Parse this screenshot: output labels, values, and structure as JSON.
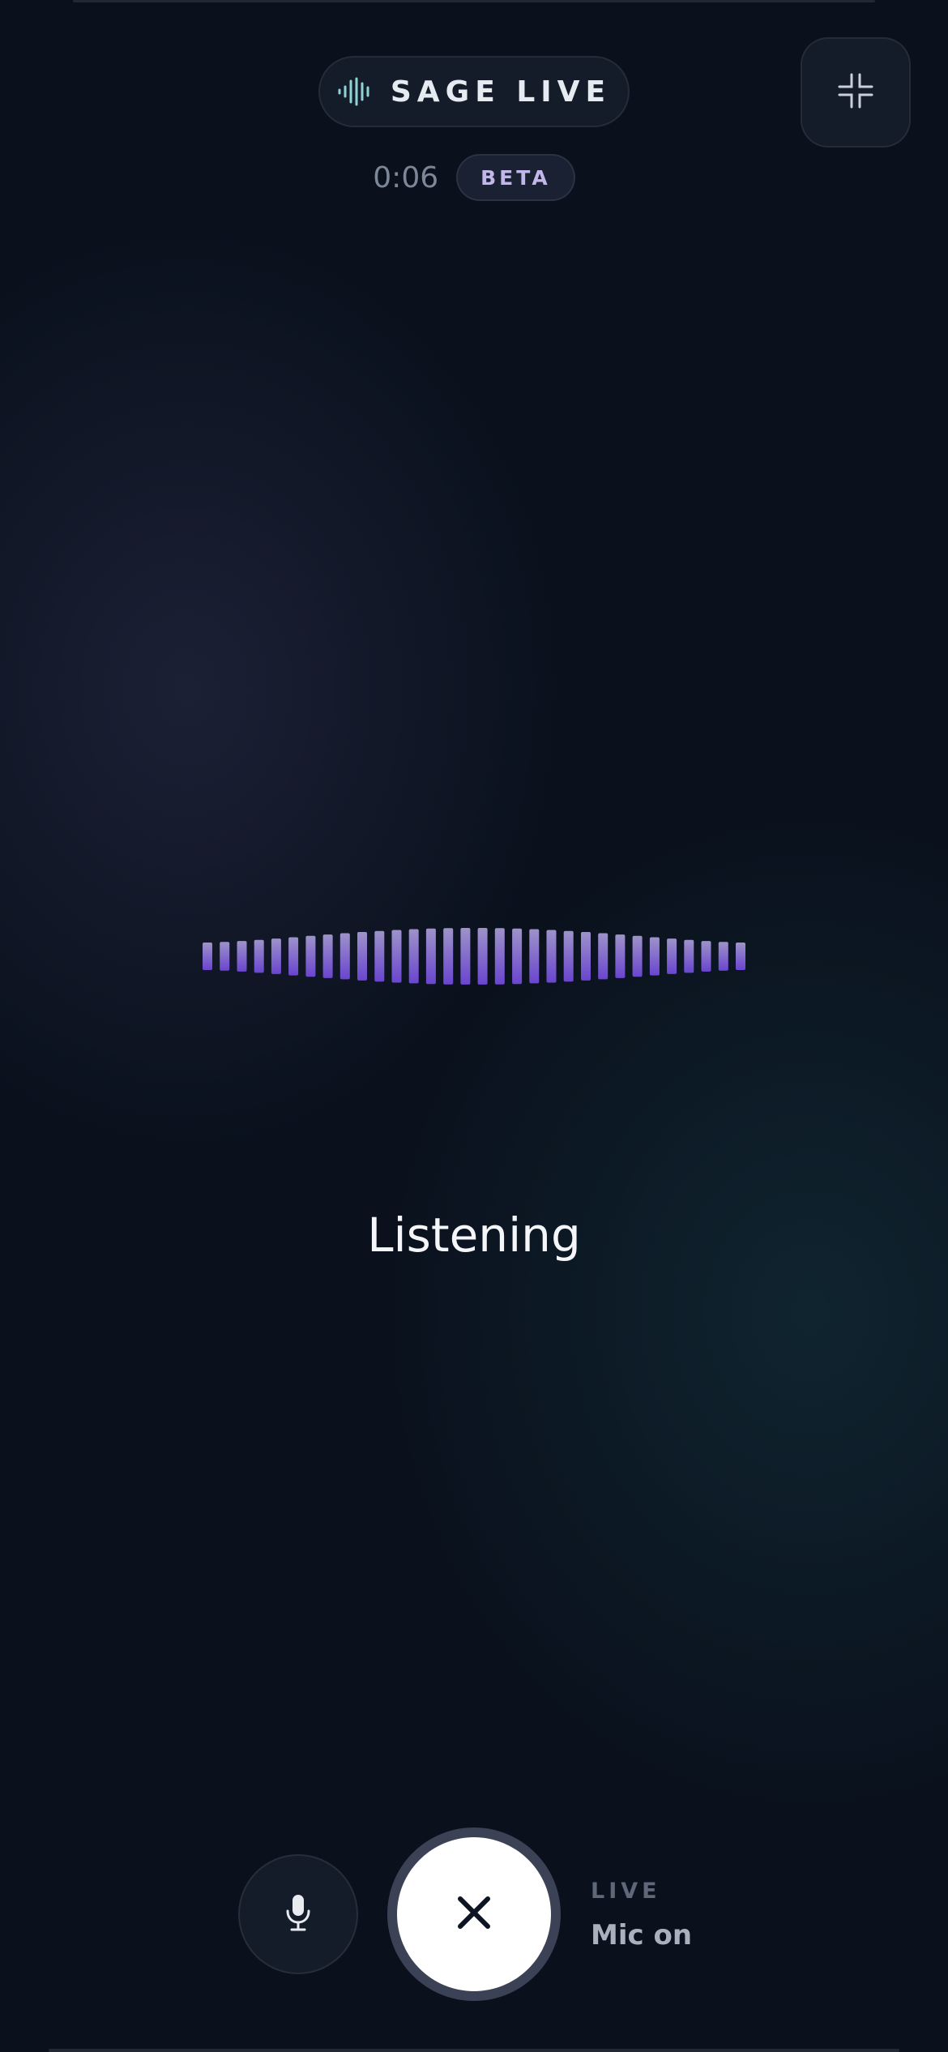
{
  "header": {
    "title": "SAGE LIVE",
    "title_icon": "waveform-icon",
    "collapse_icon": "collapse-icon",
    "timer": "0:06",
    "badge": "BETA"
  },
  "visualizer": {
    "bar_count": 32,
    "color_top": "#9d93c9",
    "color_bottom": "#6a45cf"
  },
  "status": {
    "text": "Listening"
  },
  "controls": {
    "mic_icon": "microphone-icon",
    "end_icon": "close-icon",
    "live_label": "LIVE",
    "mic_state": "Mic on"
  },
  "colors": {
    "background": "#0a111d",
    "accent": "#6a45cf",
    "badge_text": "#c3b6ea"
  }
}
